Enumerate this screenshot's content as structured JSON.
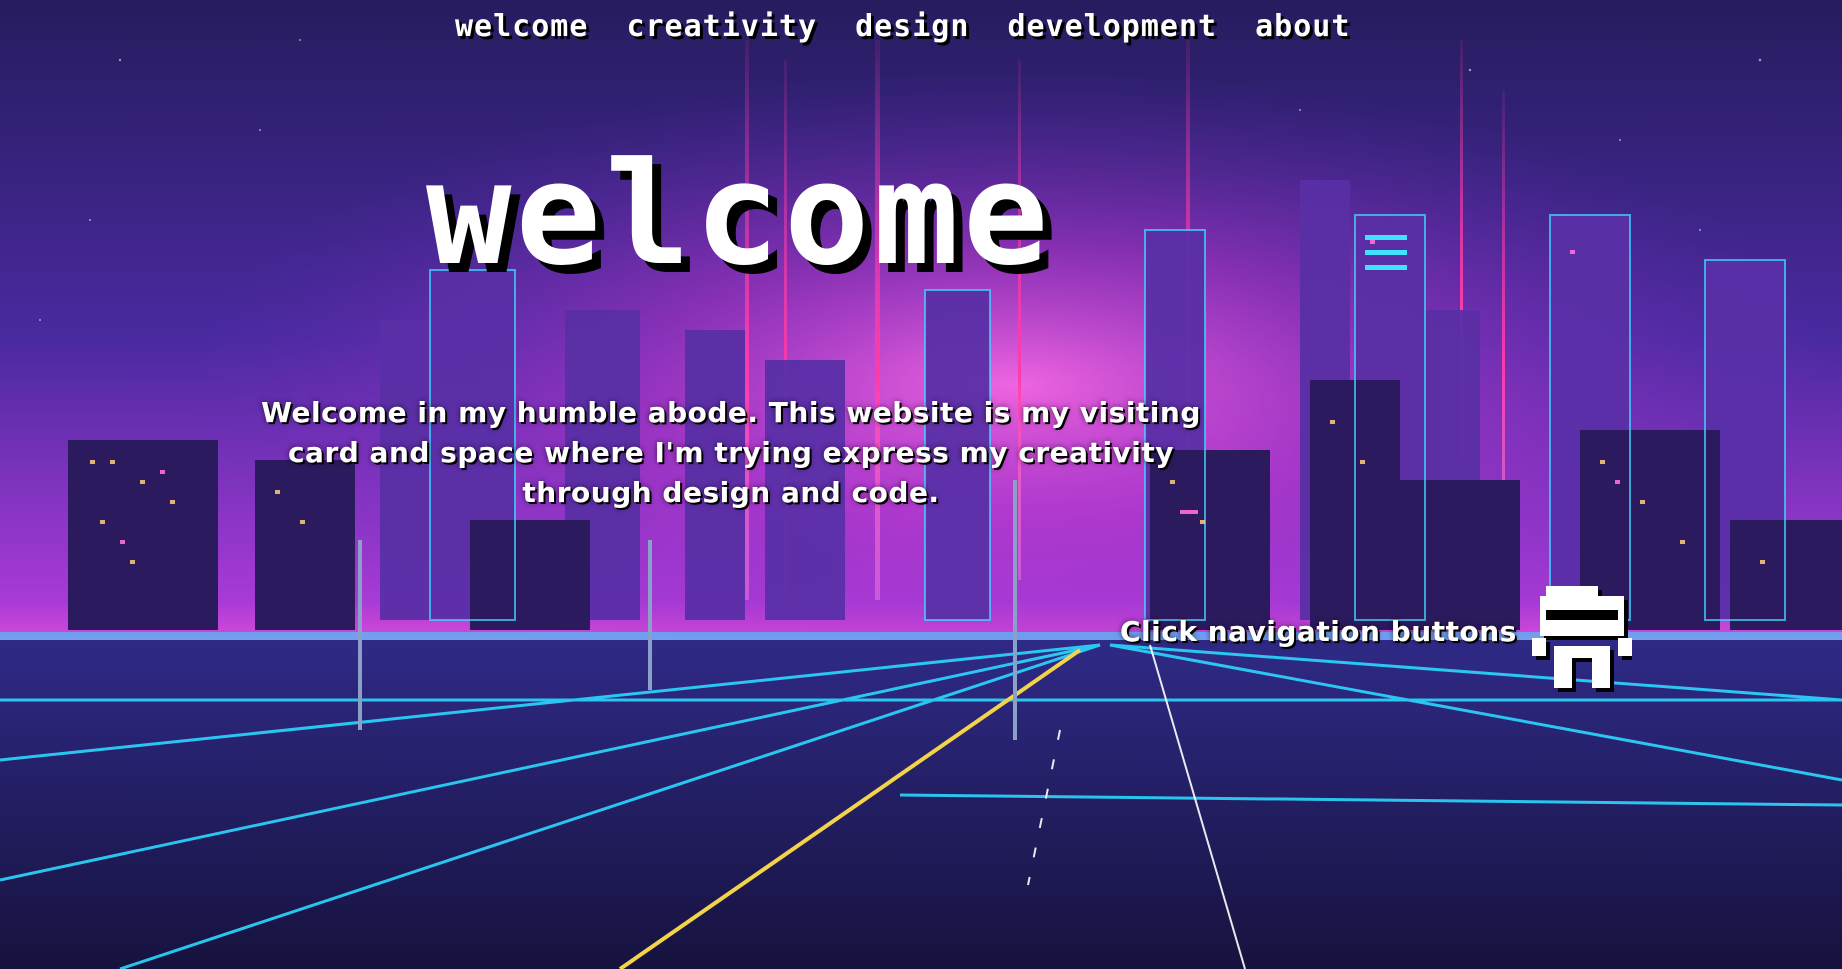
{
  "nav": {
    "items": [
      {
        "label": "welcome"
      },
      {
        "label": "creativity"
      },
      {
        "label": "design"
      },
      {
        "label": "development"
      },
      {
        "label": "about"
      }
    ]
  },
  "hero": {
    "title": "welcome",
    "intro": "Welcome in my humble abode. This website is my visiting card and space where I'm trying express my creativity through design and code."
  },
  "hint": {
    "text": "Click navigation buttons",
    "icon": "robot-icon"
  },
  "colors": {
    "sky_top": "#2a1f66",
    "sky_mid": "#7a2bc8",
    "horizon_glow": "#ff3fd8",
    "neon_cyan": "#28e6ff",
    "ground": "#1c1750",
    "text": "#ffffff",
    "shadow": "#000000"
  }
}
